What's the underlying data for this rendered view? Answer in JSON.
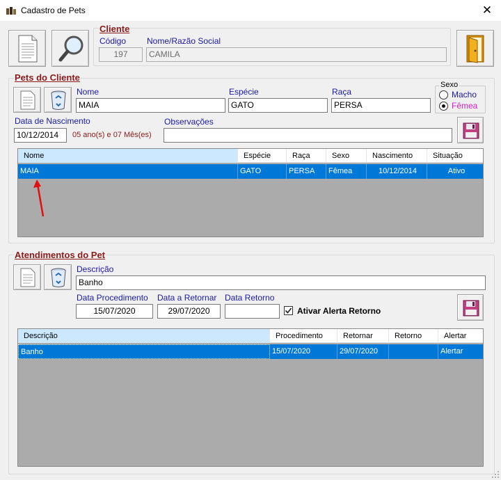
{
  "window": {
    "title": "Cadastro de Pets",
    "close_glyph": "✕"
  },
  "toolbar": {
    "new_icon": "document-icon",
    "search_icon": "magnifier-icon",
    "exit_icon": "door-exit-icon"
  },
  "cliente": {
    "group_label": "Cliente",
    "codigo_label": "Código",
    "codigo_value": "197",
    "nome_label": "Nome/Razão Social",
    "nome_value": "CAMILA"
  },
  "pets": {
    "group_label": "Pets do Cliente",
    "nome_label": "Nome",
    "nome_value": "MAIA",
    "especie_label": "Espécie",
    "especie_value": "GATO",
    "raca_label": "Raça",
    "raca_value": "PERSA",
    "sexo_label": "Sexo",
    "sexo_options": [
      "Macho",
      "Fêmea"
    ],
    "sexo_selected": "Fêmea",
    "nascimento_label": "Data de Nascimento",
    "nascimento_value": "10/12/2014",
    "idade_text": "05 ano(s) e 07 Mês(es)",
    "observacoes_label": "Observações",
    "observacoes_value": "",
    "grid": {
      "columns": [
        "Nome",
        "Espécie",
        "Raça",
        "Sexo",
        "Nascimento",
        "Situação"
      ],
      "rows": [
        {
          "nome": "MAIA",
          "especie": "GATO",
          "raca": "PERSA",
          "sexo": "Fêmea",
          "nascimento": "10/12/2014",
          "situacao": "Ativo"
        }
      ]
    }
  },
  "atendimentos": {
    "group_label": "Atendimentos do Pet",
    "descricao_label": "Descrição",
    "descricao_value": "Banho",
    "data_procedimento_label": "Data Procedimento",
    "data_procedimento_value": "15/07/2020",
    "data_a_retornar_label": "Data a Retornar",
    "data_a_retornar_value": "29/07/2020",
    "data_retorno_label": "Data Retorno",
    "data_retorno_value": "",
    "alerta_label": "Ativar Alerta Retorno",
    "alerta_checked": true,
    "grid": {
      "columns": [
        "Descrição",
        "Procedimento",
        "Retornar",
        "Retorno",
        "Alertar"
      ],
      "rows": [
        {
          "descricao": "Banho",
          "procedimento": "15/07/2020",
          "retornar": "29/07/2020",
          "retorno": "",
          "alertar": "Alertar"
        }
      ]
    }
  },
  "colors": {
    "group_label": "#8b1a1a",
    "field_label": "#1a1aa6",
    "female": "#d020d0",
    "selection": "#0078d7",
    "age_text": "#8b1a1a"
  }
}
